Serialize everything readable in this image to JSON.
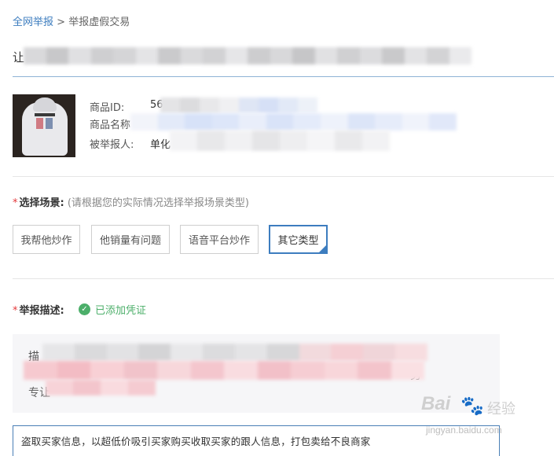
{
  "breadcrumb": {
    "link": "全网举报",
    "separator": " > ",
    "current": "举报虚假交易"
  },
  "title": {
    "prefix": "让"
  },
  "product": {
    "id_label": "商品ID:",
    "id_value": "56",
    "name_label": "商品名称",
    "reported_label": "被举报人:",
    "reported_value": "单化"
  },
  "scene": {
    "required_mark": "*",
    "label": "选择场景:",
    "hint": "(请根据您的实际情况选择举报场景类型)",
    "options": [
      "我帮他炒作",
      "他销量有问题",
      "语音平台炒作",
      "其它类型"
    ],
    "selected": "其它类型"
  },
  "description": {
    "required_mark": "*",
    "label": "举报描述:",
    "evidence_text": "已添加凭证",
    "blurred_first": "描",
    "blurred_last": "专让",
    "blurred_tail": "务"
  },
  "reason_text": "盗取买家信息，以超低价吸引买家购买收取买家的跟人信息，打包卖给不良商家",
  "watermark": {
    "brand": "Bai",
    "brand_suffix": "经验",
    "url": "jingyan.baidu.com"
  },
  "colors": {
    "accent": "#3d7dbf",
    "success": "#4caf6a",
    "required": "#e4393c"
  }
}
